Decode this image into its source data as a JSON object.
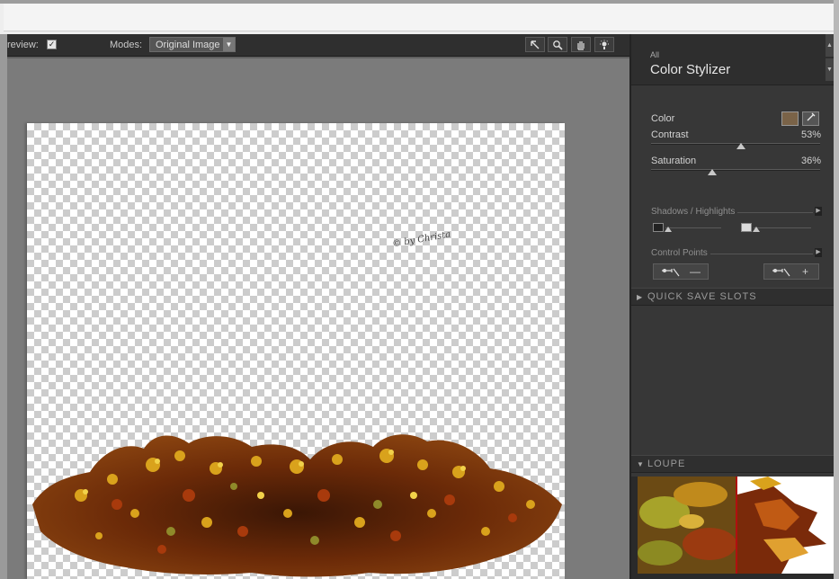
{
  "toolbar": {
    "preview_label": "review:",
    "preview_checked": "✓",
    "modes_label": "Modes:",
    "modes_value": "Original Image",
    "tools": [
      "pointer-tool-icon",
      "zoom-tool-icon",
      "hand-tool-icon",
      "lightbulb-tool-icon"
    ]
  },
  "document": {
    "watermark": "© by Christa"
  },
  "panel": {
    "category": "All",
    "title": "Color Stylizer",
    "color": {
      "label": "Color",
      "swatch_hex": "#7a6348"
    },
    "contrast": {
      "label": "Contrast",
      "value_text": "53%",
      "value": 53
    },
    "saturation": {
      "label": "Saturation",
      "value_text": "36%",
      "value": 36
    },
    "shadows_highlights": {
      "label": "Shadows / Highlights"
    },
    "control_points": {
      "label": "Control Points",
      "remove_symbol": "—",
      "add_symbol": "+"
    },
    "quick_save": {
      "label": "QUICK SAVE SLOTS"
    },
    "loupe": {
      "label": "LOUPE"
    }
  }
}
